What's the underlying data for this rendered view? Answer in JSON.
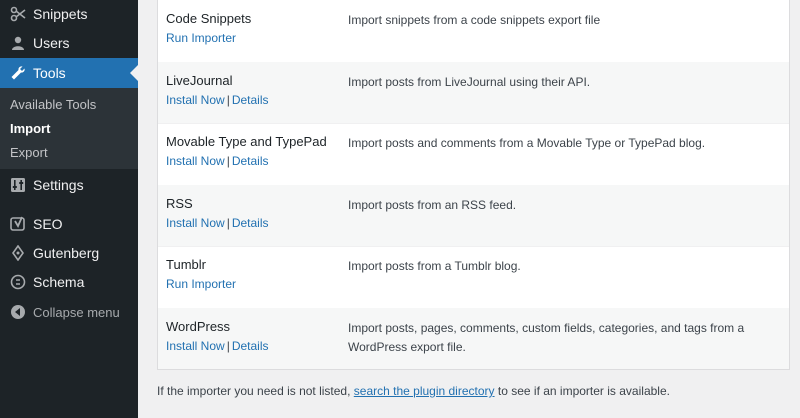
{
  "sidebar": {
    "items": [
      {
        "label": "Snippets",
        "icon": "scissors-icon"
      },
      {
        "label": "Users",
        "icon": "user-icon"
      },
      {
        "label": "Tools",
        "icon": "wrench-icon"
      },
      {
        "label": "Settings",
        "icon": "settings-icon"
      },
      {
        "label": "SEO",
        "icon": "yoast-icon"
      },
      {
        "label": "Gutenberg",
        "icon": "pen-icon"
      },
      {
        "label": "Schema",
        "icon": "schema-icon"
      }
    ],
    "submenu": [
      {
        "label": "Available Tools"
      },
      {
        "label": "Import"
      },
      {
        "label": "Export"
      }
    ],
    "collapse_label": "Collapse menu"
  },
  "importers": [
    {
      "name": "Code Snippets",
      "desc": "Import snippets from a code snippets export file",
      "action": "Run Importer"
    },
    {
      "name": "LiveJournal",
      "desc": "Import posts from LiveJournal using their API.",
      "action": "Install Now",
      "details": "Details"
    },
    {
      "name": "Movable Type and TypePad",
      "desc": "Import posts and comments from a Movable Type or TypePad blog.",
      "action": "Install Now",
      "details": "Details"
    },
    {
      "name": "RSS",
      "desc": "Import posts from an RSS feed.",
      "action": "Install Now",
      "details": "Details"
    },
    {
      "name": "Tumblr",
      "desc": "Import posts from a Tumblr blog.",
      "action": "Run Importer"
    },
    {
      "name": "WordPress",
      "desc": "Import posts, pages, comments, custom fields, categories, and tags from a WordPress export file.",
      "action": "Install Now",
      "details": "Details"
    }
  ],
  "footer": {
    "before": "If the importer you need is not listed,",
    "link": "search the plugin directory",
    "after": "to see if an importer is available."
  },
  "separator": "|",
  "colors": {
    "accent": "#2271b1",
    "sidebar": "#1d2327"
  }
}
